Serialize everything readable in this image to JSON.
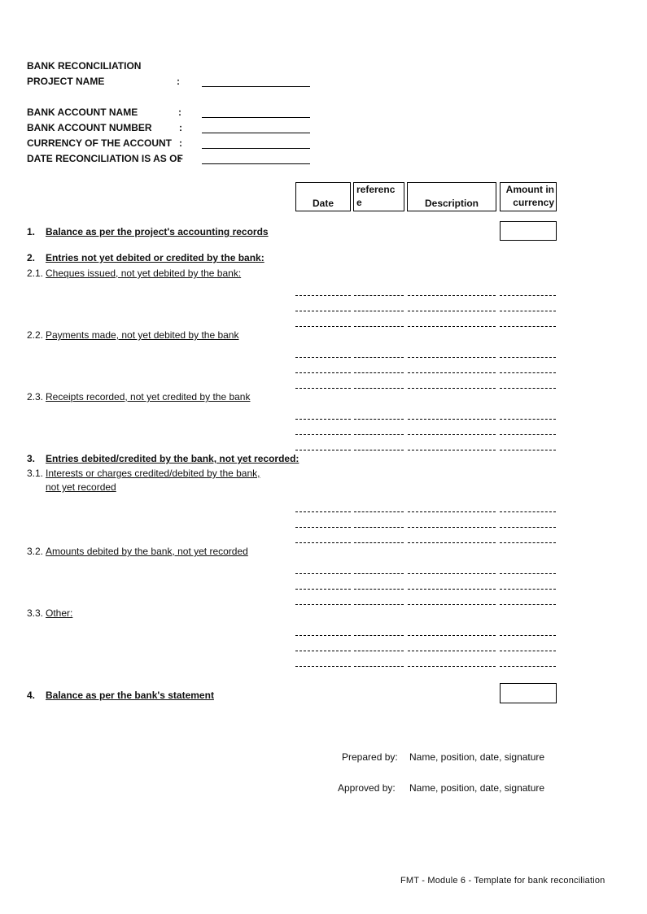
{
  "header": {
    "title": "BANK RECONCILIATION",
    "fields": [
      {
        "label": "PROJECT NAME",
        "colon": ":",
        "value": ""
      },
      {
        "label": "BANK ACCOUNT NAME",
        "colon": ":",
        "value": ""
      },
      {
        "label": "BANK ACCOUNT NUMBER",
        "colon": ":",
        "value": ""
      },
      {
        "label": "CURRENCY OF THE ACCOUNT",
        "colon": ":",
        "value": ""
      },
      {
        "label": "DATE RECONCILIATION IS AS OF",
        "colon": ":",
        "value": ""
      }
    ]
  },
  "columns": {
    "date": "Date",
    "reference_line1": "referenc",
    "reference_line2": "e",
    "description": "Description",
    "amount_line1": "Amount in",
    "amount_line2": "currency"
  },
  "sections": {
    "s1": {
      "num": "1.",
      "label": "Balance as per the project's accounting records",
      "amount": ""
    },
    "s2": {
      "num": "2.",
      "label": "Entries not yet debited or credited by the bank:"
    },
    "s2_1": {
      "num": "2.1.",
      "label": "Cheques issued, not yet debited by the bank:"
    },
    "s2_2": {
      "num": "2.2.",
      "label": "Payments made, not yet debited by the bank"
    },
    "s2_3": {
      "num": "2.3.",
      "label": "Receipts recorded, not yet credited by the bank"
    },
    "s3": {
      "num": "3.",
      "label": "Entries debited/credited by the bank, not yet recorded:"
    },
    "s3_1": {
      "num": "3.1.",
      "label_line1": "Interests or charges credited/debited by the bank,",
      "label_line2": "not yet recorded"
    },
    "s3_2": {
      "num": "3.2.",
      "label": "Amounts debited by the bank, not yet recorded"
    },
    "s3_3": {
      "num": "3.3.",
      "label": "Other:"
    },
    "s4": {
      "num": "4.",
      "label": "Balance as per the bank's statement",
      "amount": ""
    }
  },
  "entry_groups": [
    {
      "id": "2.1",
      "rows": 3
    },
    {
      "id": "2.2",
      "rows": 3
    },
    {
      "id": "2.3",
      "rows": 3
    },
    {
      "id": "3.1",
      "rows": 3
    },
    {
      "id": "3.2",
      "rows": 3
    },
    {
      "id": "3.3",
      "rows": 3
    }
  ],
  "signoff": {
    "prepared_label": "Prepared by:",
    "prepared_value": "Name, position, date, signature",
    "approved_label": "Approved by:",
    "approved_value": "Name, position, date, signature"
  },
  "footer": "FMT - Module 6 - Template for bank reconciliation"
}
